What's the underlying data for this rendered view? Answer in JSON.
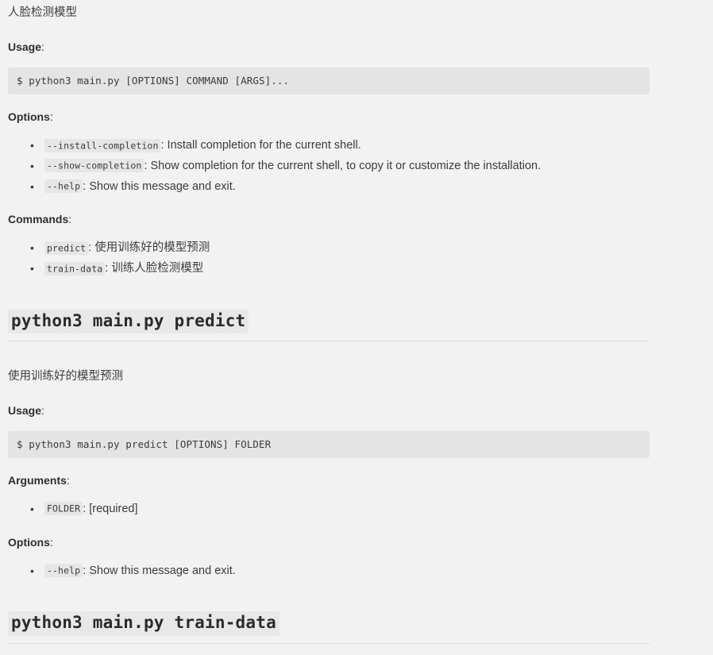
{
  "doc": {
    "intro_text": "人脸检测模型",
    "main": {
      "usage_label": "Usage",
      "usage_colon": ":",
      "usage_code": "$ python3 main.py [OPTIONS] COMMAND [ARGS]...",
      "options_label": "Options",
      "options_colon": ":",
      "options": [
        {
          "code": "--install-completion",
          "sep": ": ",
          "desc": "Install completion for the current shell."
        },
        {
          "code": "--show-completion",
          "sep": ": ",
          "desc": "Show completion for the current shell, to copy it or customize the installation."
        },
        {
          "code": "--help",
          "sep": ": ",
          "desc": "Show this message and exit."
        }
      ],
      "commands_label": "Commands",
      "commands_colon": ":",
      "commands": [
        {
          "code": "predict",
          "sep": ": ",
          "desc": "使用训练好的模型预测"
        },
        {
          "code": "train-data",
          "sep": ": ",
          "desc": "训练人脸检测模型"
        }
      ]
    },
    "predict": {
      "heading": "python3 main.py predict",
      "description": "使用训练好的模型预测",
      "usage_label": "Usage",
      "usage_colon": ":",
      "usage_code": "$ python3 main.py predict [OPTIONS] FOLDER",
      "arguments_label": "Arguments",
      "arguments_colon": ":",
      "arguments": [
        {
          "code": "FOLDER",
          "sep": ": ",
          "desc": "[required]"
        }
      ],
      "options_label": "Options",
      "options_colon": ":",
      "options": [
        {
          "code": "--help",
          "sep": ": ",
          "desc": "Show this message and exit."
        }
      ]
    },
    "train_data": {
      "heading": "python3 main.py train-data"
    }
  },
  "colors": {
    "page_background": "#f2f2f2",
    "code_block_background": "#e4e4e4",
    "inline_code_background": "#e6e6e6",
    "heading_code_background": "#e8e8e8",
    "text": "#3c3c3c",
    "divider": "#dcdcdc"
  }
}
